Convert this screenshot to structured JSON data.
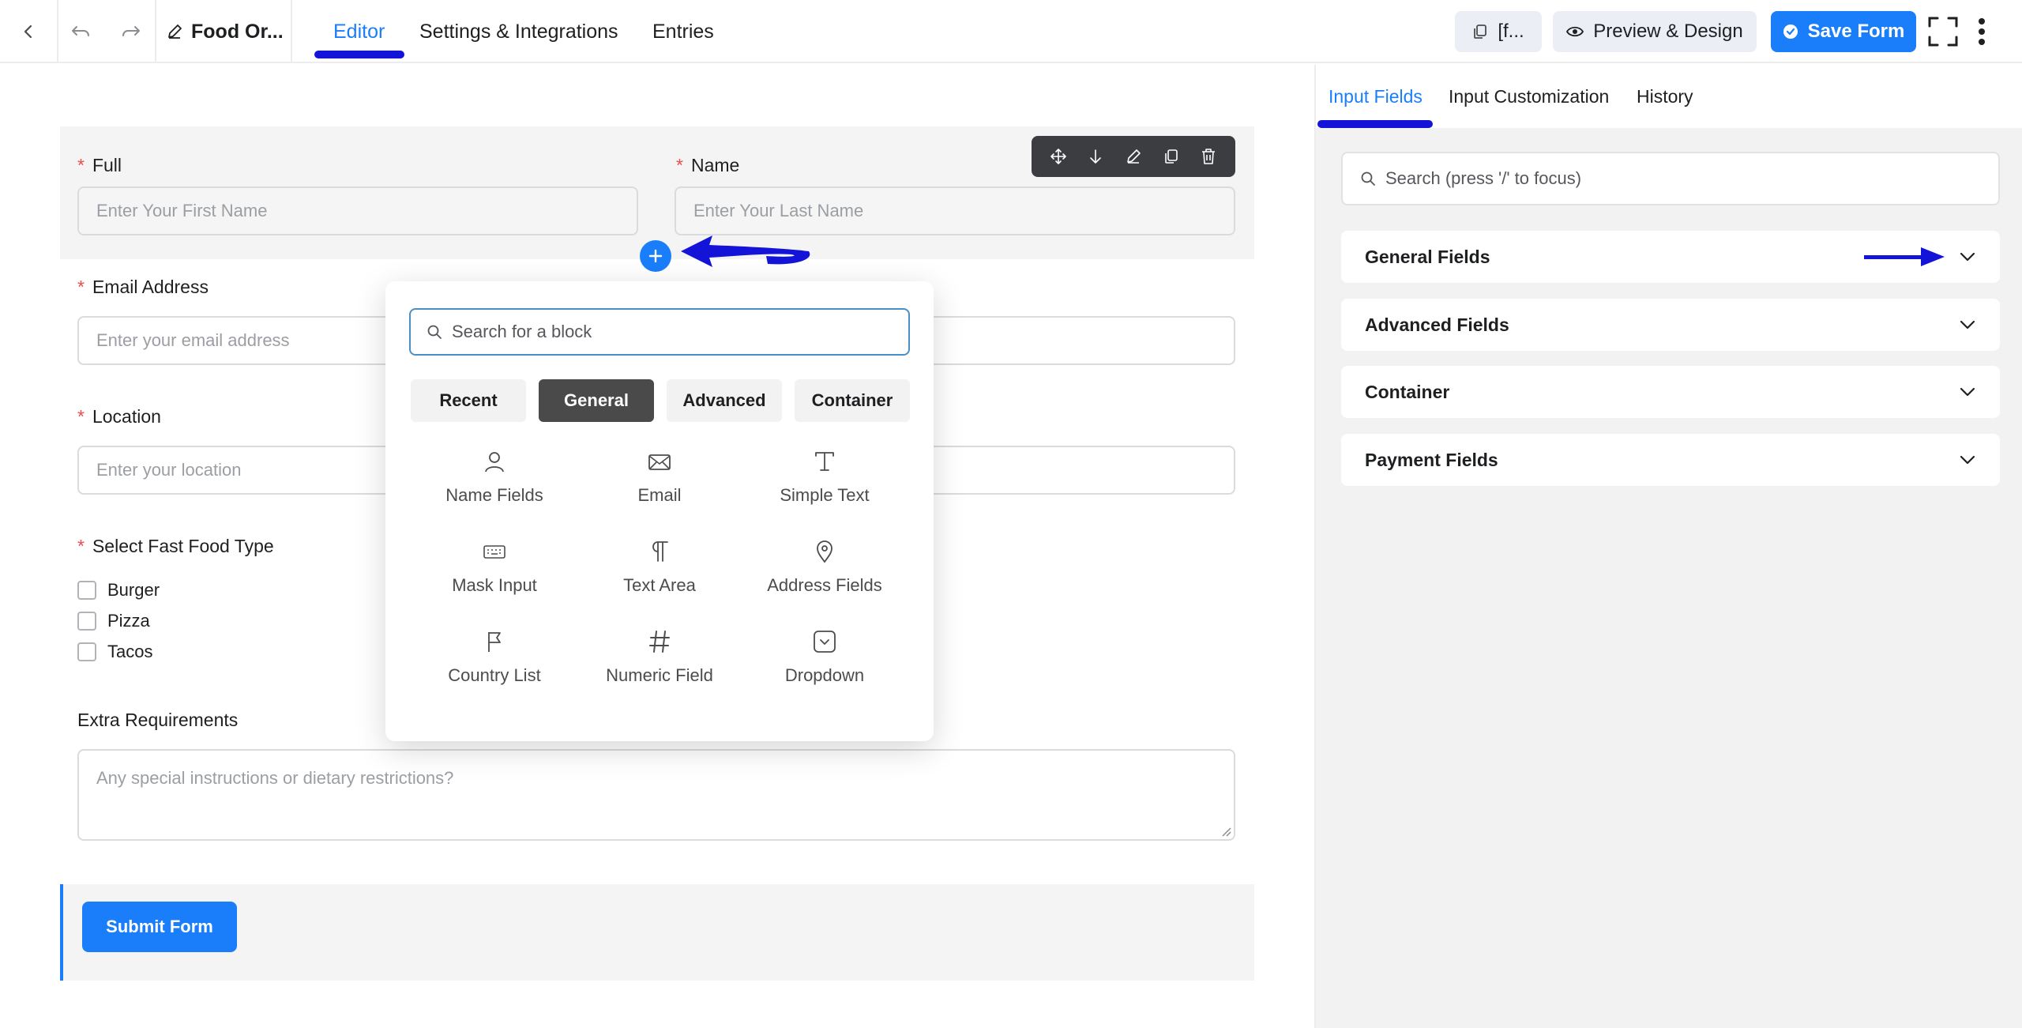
{
  "topbar": {
    "form_title": "Food Or...",
    "tabs": [
      {
        "label": "Editor",
        "active": true
      },
      {
        "label": "Settings & Integrations",
        "active": false
      },
      {
        "label": "Entries",
        "active": false
      }
    ],
    "shortcode_label": "[f...",
    "preview_label": "Preview & Design",
    "save_label": "Save Form"
  },
  "form": {
    "fields": {
      "first_name": {
        "label": "Full",
        "placeholder": "Enter Your First Name"
      },
      "last_name": {
        "label": "Name",
        "placeholder": "Enter Your Last Name"
      },
      "email": {
        "label": "Email Address",
        "placeholder": "Enter your email address"
      },
      "location": {
        "label": "Location",
        "placeholder": "Enter your location"
      },
      "food_type": {
        "label": "Select Fast Food Type",
        "options": [
          "Burger",
          "Pizza",
          "Tacos"
        ]
      },
      "extra": {
        "label": "Extra Requirements",
        "placeholder": "Any special instructions or dietary restrictions?"
      }
    },
    "required_marker": "*",
    "submit_label": "Submit Form"
  },
  "block_picker": {
    "search_placeholder": "Search for a block",
    "tabs": [
      {
        "label": "Recent",
        "active": false
      },
      {
        "label": "General",
        "active": true
      },
      {
        "label": "Advanced",
        "active": false
      },
      {
        "label": "Container",
        "active": false
      }
    ],
    "blocks": [
      {
        "label": "Name Fields",
        "icon": "person-icon"
      },
      {
        "label": "Email",
        "icon": "envelope-icon"
      },
      {
        "label": "Simple Text",
        "icon": "text-icon"
      },
      {
        "label": "Mask Input",
        "icon": "keyboard-icon"
      },
      {
        "label": "Text Area",
        "icon": "paragraph-icon"
      },
      {
        "label": "Address Fields",
        "icon": "map-pin-icon"
      },
      {
        "label": "Country List",
        "icon": "flag-icon"
      },
      {
        "label": "Numeric Field",
        "icon": "hash-icon"
      },
      {
        "label": "Dropdown",
        "icon": "dropdown-icon"
      }
    ]
  },
  "sidebar": {
    "tabs": [
      {
        "label": "Input Fields",
        "active": true
      },
      {
        "label": "Input Customization",
        "active": false
      },
      {
        "label": "History",
        "active": false
      }
    ],
    "search_placeholder": "Search (press '/' to focus)",
    "sections": [
      "General Fields",
      "Advanced Fields",
      "Container",
      "Payment Fields"
    ]
  },
  "colors": {
    "accent": "#1a7efb",
    "annotation": "#1414d9",
    "required": "#f04b4b"
  }
}
